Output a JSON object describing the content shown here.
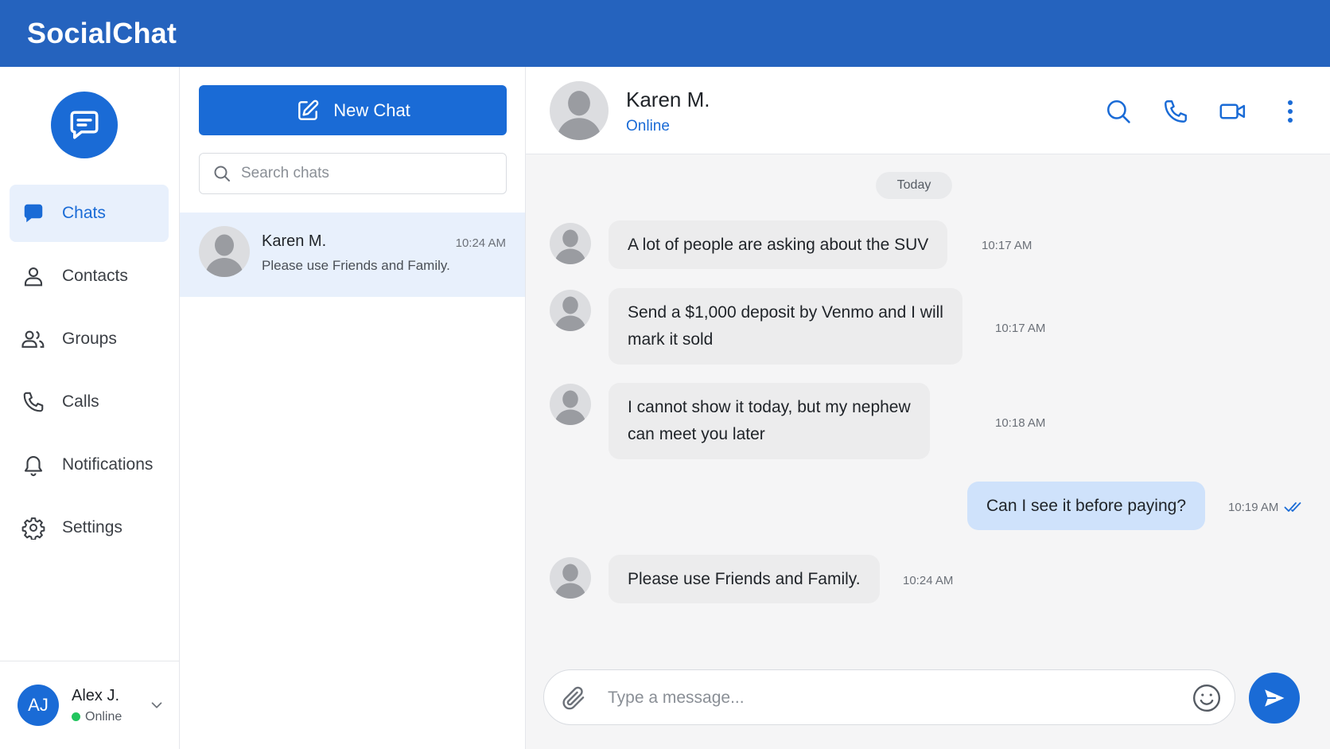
{
  "app": {
    "title": "SocialChat"
  },
  "colors": {
    "header": "#2563be",
    "accent": "#1a6bd6",
    "selected": "#e8f0fc",
    "incoming_bubble": "#ececed",
    "outgoing_bubble": "#cfe2fb",
    "online": "#22c55e"
  },
  "nav": {
    "logo_icon": "chat-bubble-icon",
    "items": [
      {
        "label": "Chats",
        "icon": "chat-bubble-icon",
        "active": true
      },
      {
        "label": "Contacts",
        "icon": "person-icon",
        "active": false
      },
      {
        "label": "Groups",
        "icon": "group-icon",
        "active": false
      },
      {
        "label": "Calls",
        "icon": "phone-icon",
        "active": false
      },
      {
        "label": "Notifications",
        "icon": "bell-icon",
        "active": false
      },
      {
        "label": "Settings",
        "icon": "gear-icon",
        "active": false
      }
    ],
    "user": {
      "initials": "AJ",
      "name": "Alex J.",
      "status": "Online"
    }
  },
  "chat_list": {
    "new_chat_label": "New Chat",
    "search_placeholder": "Search chats",
    "chats": [
      {
        "name": "Karen M.",
        "time": "10:24 AM",
        "preview": "Please use Friends and Family.",
        "selected": true
      }
    ]
  },
  "conversation": {
    "contact_name": "Karen M.",
    "contact_status": "Online",
    "day_label": "Today",
    "messages": [
      {
        "direction": "in",
        "lines": [
          "A lot of people are asking about the SUV"
        ],
        "time": "10:17 AM"
      },
      {
        "direction": "in",
        "lines": [
          "Send a $1,000 deposit by Venmo and I will",
          "mark it sold"
        ],
        "time": "10:17 AM"
      },
      {
        "direction": "in",
        "lines": [
          "I cannot show it today, but my nephew",
          "can meet you later"
        ],
        "time": "10:18 AM"
      },
      {
        "direction": "out",
        "lines": [
          "Can I see it before paying?"
        ],
        "time": "10:19 AM",
        "read": true
      },
      {
        "direction": "in",
        "lines": [
          "Please use Friends and Family."
        ],
        "time": "10:24 AM"
      }
    ],
    "composer_placeholder": "Type a message..."
  }
}
